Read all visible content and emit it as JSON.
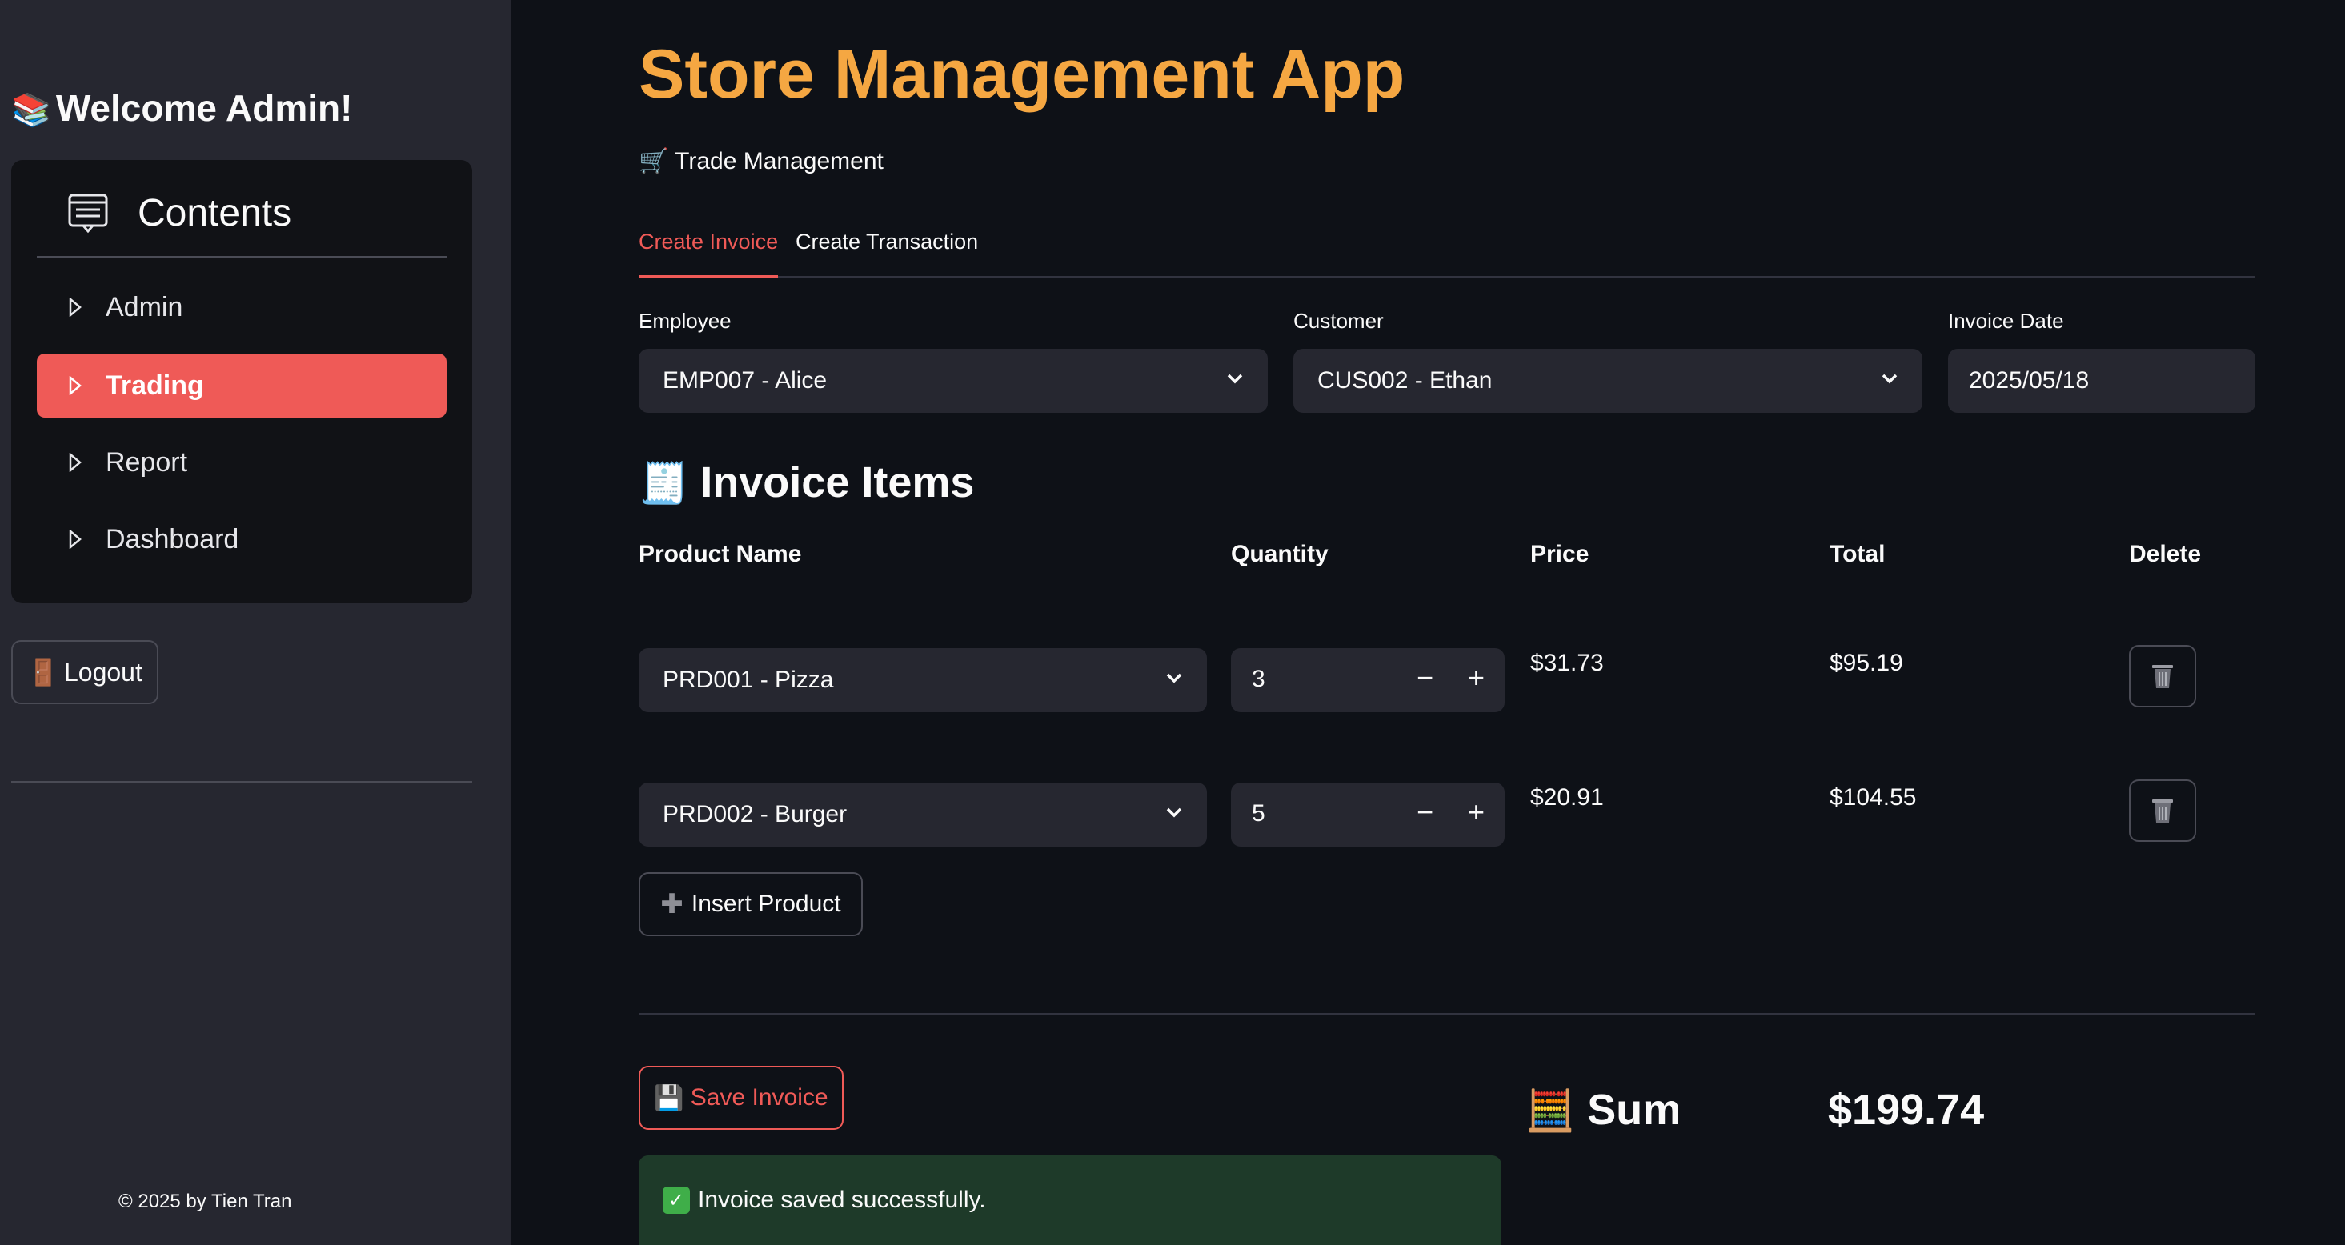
{
  "sidebar": {
    "welcome_emoji": "📚",
    "welcome": "Welcome Admin!",
    "menu_title": "Contents",
    "items": [
      {
        "label": "Admin"
      },
      {
        "label": "Trading"
      },
      {
        "label": "Report"
      },
      {
        "label": "Dashboard"
      }
    ],
    "active_item": "Trading",
    "logout_emoji": "🚪",
    "logout_label": "Logout",
    "footer": "© 2025 by Tien Tran"
  },
  "header": {
    "title": "Store Management App",
    "subtitle_emoji": "🛒",
    "subtitle": "Trade Management"
  },
  "tabs": [
    {
      "label": "Create Invoice"
    },
    {
      "label": "Create Transaction"
    }
  ],
  "active_tab": "Create Invoice",
  "form": {
    "employee_label": "Employee",
    "employee_value": "EMP007 - Alice",
    "customer_label": "Customer",
    "customer_value": "CUS002 - Ethan",
    "date_label": "Invoice Date",
    "date_value": "2025/05/18"
  },
  "invoice": {
    "section_emoji": "🧾",
    "section_title": "Invoice Items",
    "columns": {
      "product": "Product Name",
      "quantity": "Quantity",
      "price": "Price",
      "total": "Total",
      "delete": "Delete"
    },
    "rows": [
      {
        "product": "PRD001 - Pizza",
        "quantity": "3",
        "price": "$31.73",
        "total": "$95.19"
      },
      {
        "product": "PRD002 - Burger",
        "quantity": "5",
        "price": "$20.91",
        "total": "$104.55"
      }
    ],
    "insert_label": "Insert Product",
    "save_emoji": "💾",
    "save_label": "Save Invoice",
    "sum_emoji": "🧮",
    "sum_label": "Sum",
    "sum_value": "$199.74",
    "success_message": "Invoice saved successfully."
  },
  "colors": {
    "accent": "#ef5a57",
    "title": "#f5a742",
    "success_bg": "#1e3a29"
  }
}
